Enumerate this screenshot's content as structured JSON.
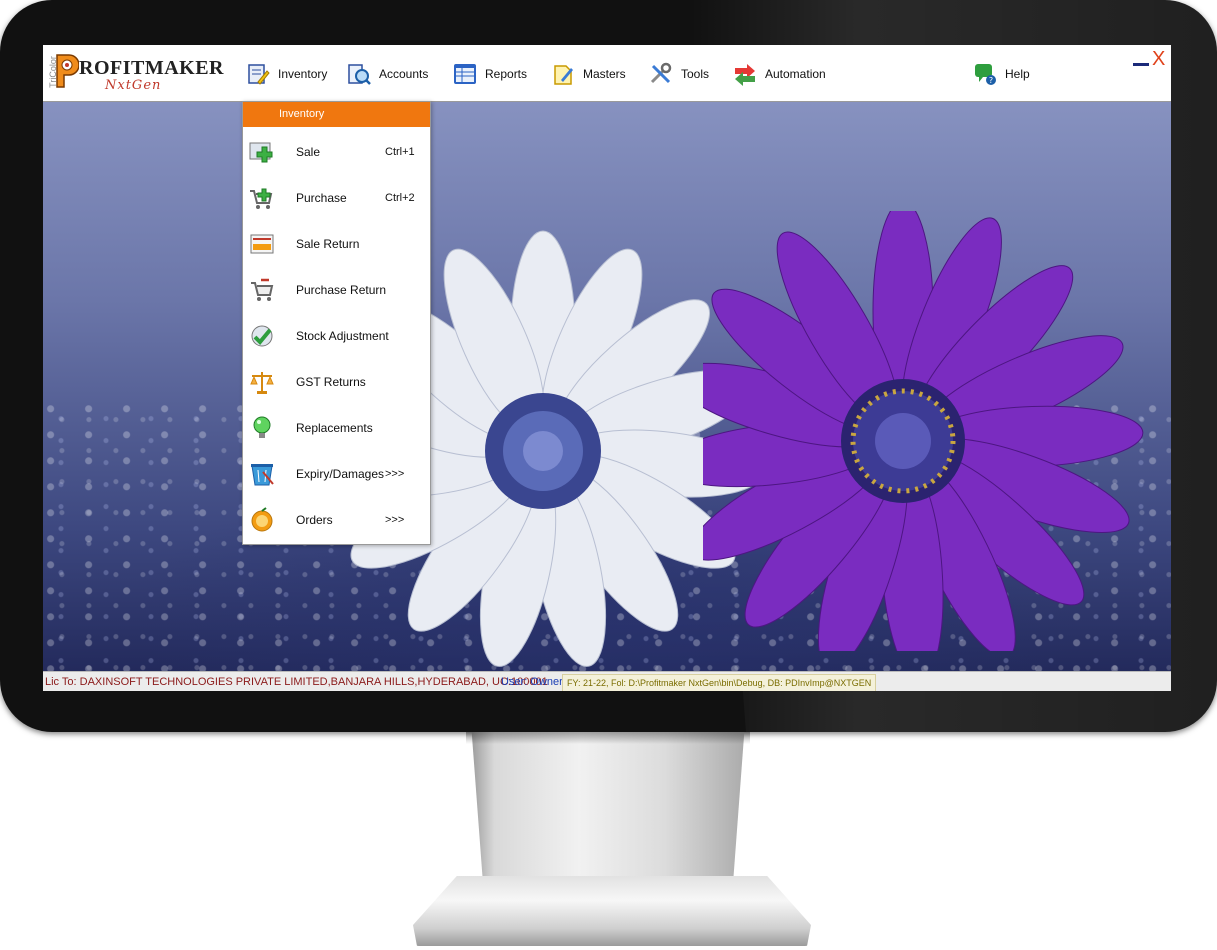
{
  "app": {
    "brand_vertical": "TriColor",
    "brand_name": "ROFITMAKER",
    "brand_sub": "NxtGen"
  },
  "nav": {
    "items": [
      {
        "label": "Inventory",
        "icon": "inventory-icon"
      },
      {
        "label": "Accounts",
        "icon": "accounts-icon"
      },
      {
        "label": "Reports",
        "icon": "reports-icon"
      },
      {
        "label": "Masters",
        "icon": "masters-icon"
      },
      {
        "label": "Tools",
        "icon": "tools-icon"
      },
      {
        "label": "Automation",
        "icon": "automation-icon"
      },
      {
        "label": "Help",
        "icon": "help-icon"
      }
    ]
  },
  "window": {
    "minimize_glyph": "—",
    "close_glyph": "X"
  },
  "dropdown": {
    "title": "Inventory",
    "items": [
      {
        "label": "Sale",
        "shortcut": "Ctrl+1",
        "icon": "sale-icon"
      },
      {
        "label": "Purchase",
        "shortcut": "Ctrl+2",
        "icon": "purchase-icon"
      },
      {
        "label": "Sale Return",
        "shortcut": "",
        "icon": "sale-return-icon"
      },
      {
        "label": "Purchase Return",
        "shortcut": "",
        "icon": "purchase-return-icon"
      },
      {
        "label": "Stock Adjustment",
        "shortcut": "",
        "icon": "stock-adjustment-icon"
      },
      {
        "label": "GST Returns",
        "shortcut": "",
        "icon": "gst-returns-icon"
      },
      {
        "label": "Replacements",
        "shortcut": "",
        "icon": "replacements-icon"
      },
      {
        "label": "Expiry/Damages",
        "shortcut": ">>>",
        "icon": "expiry-damages-icon"
      },
      {
        "label": "Orders",
        "shortcut": ">>>",
        "icon": "orders-icon"
      }
    ]
  },
  "status": {
    "license": "Lic To: DAXINSOFT TECHNOLOGIES PRIVATE LIMITED,BANJARA HILLS,HYDERABAD, UC:100001",
    "user": "User: Owner",
    "fy": "FY: 21-22, Fol: D:\\Profitmaker NxtGen\\bin\\Debug, DB: PDInvImp@NXTGEN"
  },
  "colors": {
    "accent": "#f0770f",
    "license_text": "#8b1a1a",
    "user_text": "#1a3db5",
    "close": "#e0421b"
  }
}
